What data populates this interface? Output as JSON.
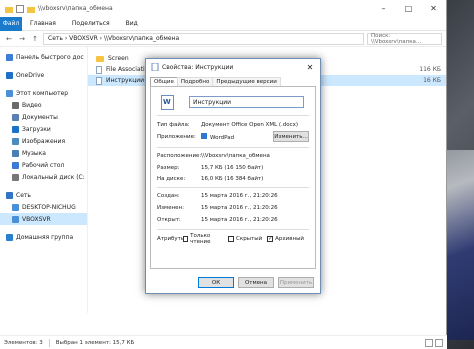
{
  "colors": {
    "accent": "#1979ca",
    "selection": "#cce8ff",
    "folder": "#f5c542"
  },
  "explorer": {
    "title": "\\\\vboxsrv\\папка_обмена",
    "ribbon": {
      "file_tab": "Файл",
      "tabs": [
        "Главная",
        "Поделиться",
        "Вид"
      ]
    },
    "address": "Сеть › VBOXSVR › \\\\Vboxsrv\\папка_обмена",
    "search_placeholder": "Поиск: \\\\Vboxsrv\\папка...",
    "sidebar": [
      {
        "label": "Панель быстрого дос",
        "icon": "star-icon",
        "indent": false
      },
      {
        "label": "OneDrive",
        "icon": "cloud-icon",
        "indent": false
      },
      {
        "label": "Этот компьютер",
        "icon": "computer-icon",
        "indent": false
      },
      {
        "label": "Видео",
        "icon": "video-icon",
        "indent": true
      },
      {
        "label": "Документы",
        "icon": "documents-icon",
        "indent": true
      },
      {
        "label": "Загрузки",
        "icon": "download-icon",
        "indent": true
      },
      {
        "label": "Изображения",
        "icon": "pictures-icon",
        "indent": true
      },
      {
        "label": "Музыка",
        "icon": "music-icon",
        "indent": true
      },
      {
        "label": "Рабочий стол",
        "icon": "desktop-icon",
        "indent": true
      },
      {
        "label": "Локальный диск (C:",
        "icon": "drive-icon",
        "indent": true
      },
      {
        "label": "Сеть",
        "icon": "network-icon",
        "indent": false
      },
      {
        "label": "DESKTOP-NICHUG",
        "icon": "computer-icon",
        "indent": true
      },
      {
        "label": "VBOXSVR",
        "icon": "computer-icon",
        "indent": true
      },
      {
        "label": "Домашняя группа",
        "icon": "homegroup-icon",
        "indent": false
      }
    ],
    "files": [
      {
        "name": "Screen",
        "type": "folder",
        "size": ""
      },
      {
        "name": "File Association F",
        "type": "doc",
        "size": "116 КБ"
      },
      {
        "name": "Инструкции",
        "type": "doc",
        "size": "16 КБ"
      }
    ],
    "status": {
      "count": "Элементов: 3",
      "selected": "Выбран 1 элемент: 15,7 КБ"
    }
  },
  "dialog": {
    "title": "Свойства: Инструкции",
    "tabs": [
      "Общие",
      "Подробно",
      "Предыдущие версии"
    ],
    "filename": "Инструкции",
    "type_label": "Тип файла:",
    "type_value": "Документ Office Open XML (.docx)",
    "app_label": "Приложение:",
    "app_value": "WordPad",
    "change_button": "Изменить...",
    "location_label": "Расположение:",
    "location_value": "\\\\Vboxsrv\\папка_обмена",
    "size_label": "Размер:",
    "size_value": "15,7 КБ (16 150 байт)",
    "disk_label": "На диске:",
    "disk_value": "16,0 КБ (16 384 байт)",
    "created_label": "Создан:",
    "created_value": "15 марта 2016 г., 21:20:26",
    "modified_label": "Изменен:",
    "modified_value": "15 марта 2016 г., 21:20:26",
    "opened_label": "Открыт:",
    "opened_value": "15 марта 2016 г., 21:20:26",
    "attr_label": "Атрибуты:",
    "attr_readonly": "Только чтение",
    "attr_hidden": "Скрытый",
    "attr_archive": "Архивный",
    "ok": "ОК",
    "cancel": "Отмена",
    "apply": "Применить"
  }
}
